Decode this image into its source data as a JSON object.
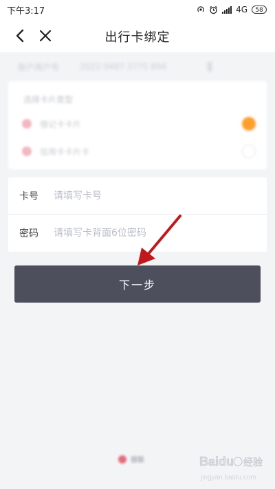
{
  "status_bar": {
    "time": "下午3:17",
    "network": "4G",
    "battery": "58"
  },
  "nav": {
    "title": "出行卡绑定"
  },
  "account": {
    "label": "账户用户号",
    "value": "2022 0487 3775 894"
  },
  "card_type": {
    "title": "选择卡片类型",
    "options": [
      {
        "label": "借记卡卡片",
        "selected": true
      },
      {
        "label": "信用卡卡片卡",
        "selected": false
      }
    ],
    "accent_color": "#ff9e2c"
  },
  "form": {
    "card_number_label": "卡号",
    "card_number_placeholder": "请填写卡号",
    "password_label": "密码",
    "password_placeholder": "请填写卡背面6位密码"
  },
  "next_button": {
    "label": "下一步",
    "color": "#4d4f5d"
  },
  "footer": {
    "brand": "银联"
  },
  "annotation": {
    "arrow_color": "#c0181c"
  },
  "watermark": {
    "logo_text": "Baidu",
    "cn_text": "经验",
    "url": "jingyan.baidu.com"
  }
}
